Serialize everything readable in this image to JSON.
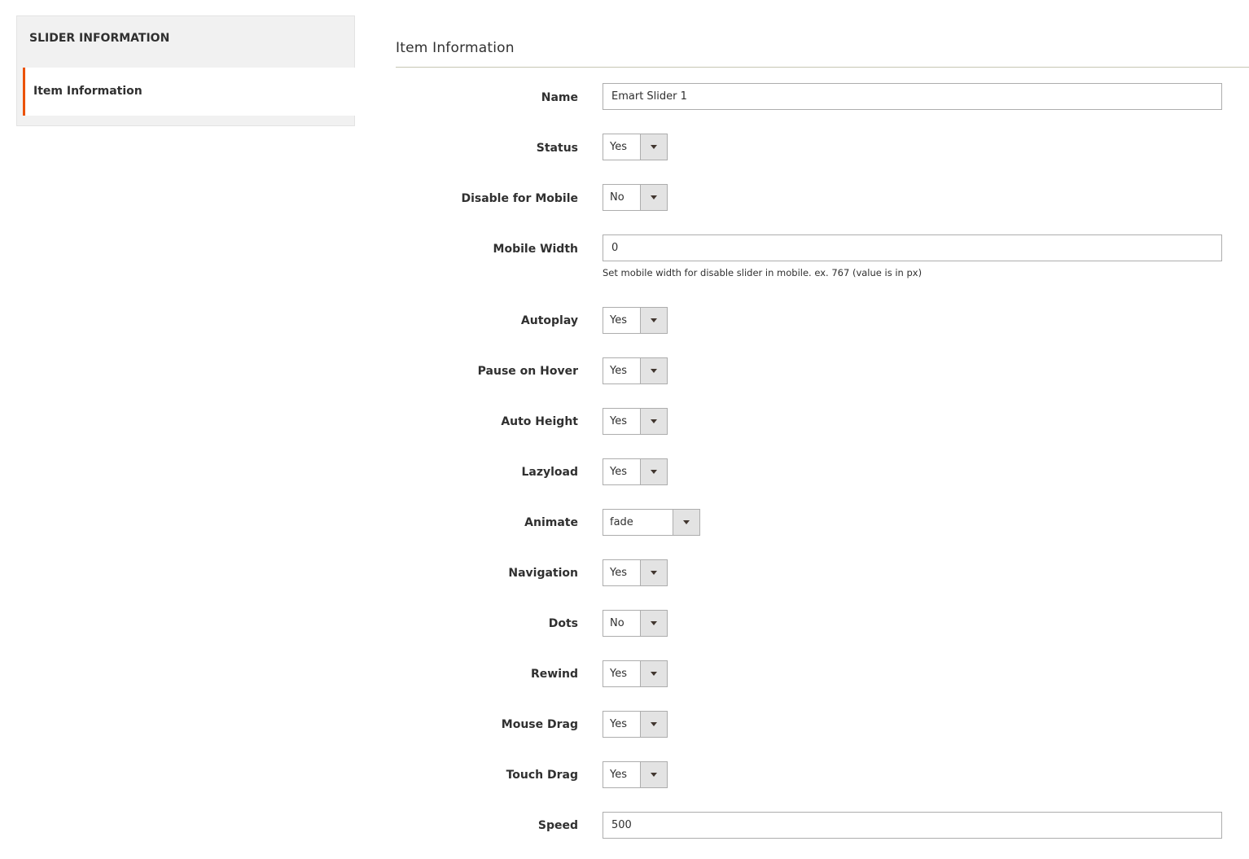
{
  "sidebar": {
    "title": "SLIDER INFORMATION",
    "items": [
      {
        "label": "Item Information"
      }
    ]
  },
  "section": {
    "title": "Item Information"
  },
  "form": {
    "name": {
      "label": "Name",
      "value": "Emart Slider 1"
    },
    "status": {
      "label": "Status",
      "value": "Yes"
    },
    "disable_mobile": {
      "label": "Disable for Mobile",
      "value": "No"
    },
    "mobile_width": {
      "label": "Mobile Width",
      "value": "0",
      "note": "Set mobile width for disable slider in mobile. ex. 767 (value is in px)"
    },
    "autoplay": {
      "label": "Autoplay",
      "value": "Yes"
    },
    "pause_on_hover": {
      "label": "Pause on Hover",
      "value": "Yes"
    },
    "auto_height": {
      "label": "Auto Height",
      "value": "Yes"
    },
    "lazyload": {
      "label": "Lazyload",
      "value": "Yes"
    },
    "animate": {
      "label": "Animate",
      "value": "fade"
    },
    "navigation": {
      "label": "Navigation",
      "value": "Yes"
    },
    "dots": {
      "label": "Dots",
      "value": "No"
    },
    "rewind": {
      "label": "Rewind",
      "value": "Yes"
    },
    "mouse_drag": {
      "label": "Mouse Drag",
      "value": "Yes"
    },
    "touch_drag": {
      "label": "Touch Drag",
      "value": "Yes"
    },
    "speed": {
      "label": "Speed",
      "value": "500"
    }
  },
  "colors": {
    "accent": "#eb5202",
    "border": "#adadad",
    "sidebar_bg": "#f1f1f1"
  }
}
